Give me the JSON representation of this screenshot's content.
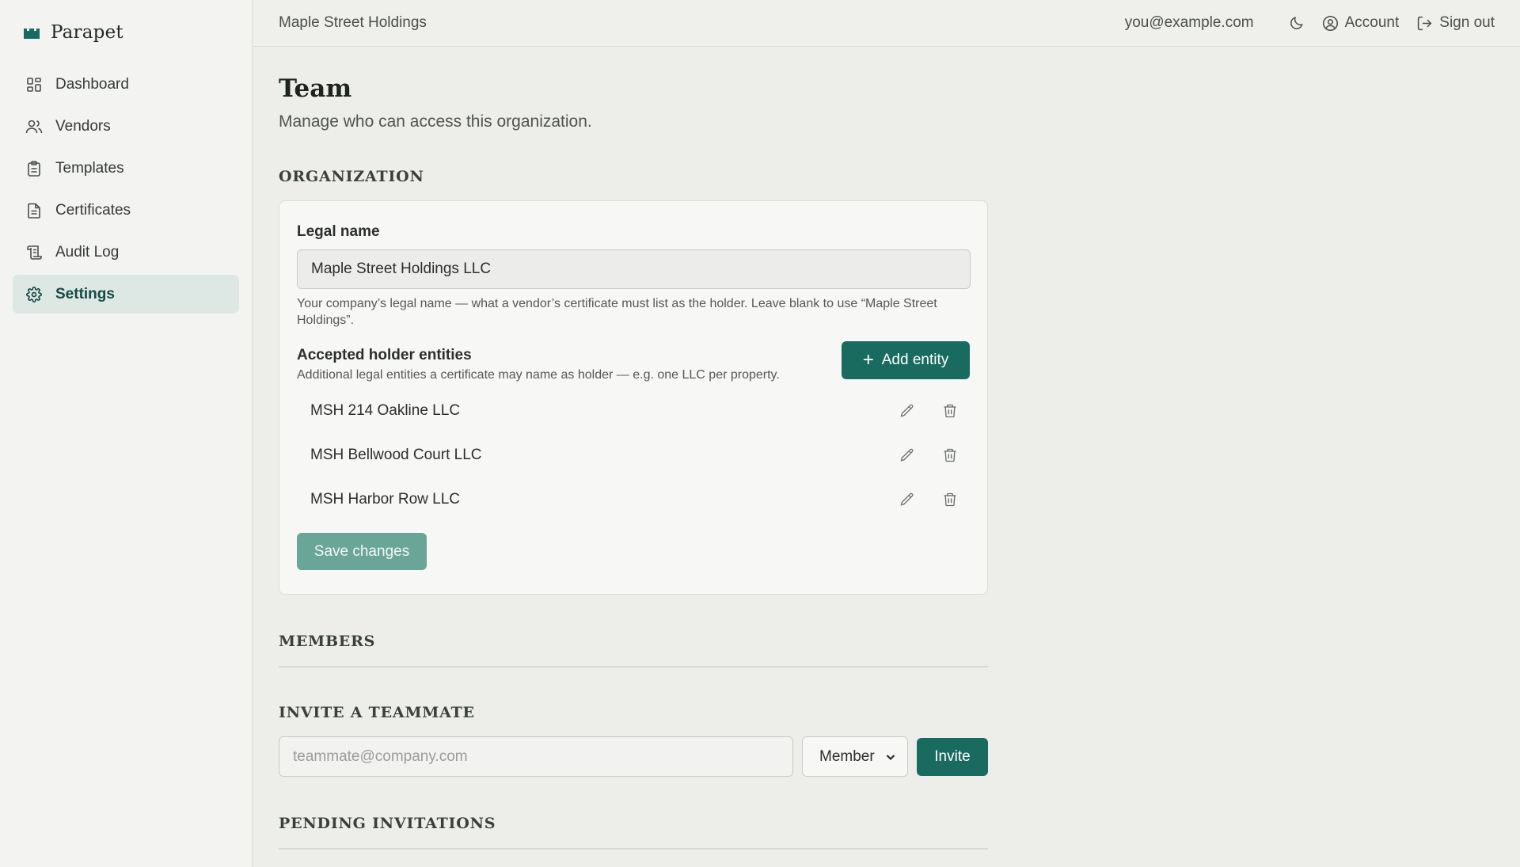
{
  "brand": {
    "name": "Parapet",
    "accent": "#1a6b5f"
  },
  "sidebar": {
    "items": [
      {
        "label": "Dashboard",
        "icon": "dashboard-icon",
        "active": false
      },
      {
        "label": "Vendors",
        "icon": "users-icon",
        "active": false
      },
      {
        "label": "Templates",
        "icon": "clipboard-icon",
        "active": false
      },
      {
        "label": "Certificates",
        "icon": "document-icon",
        "active": false
      },
      {
        "label": "Audit Log",
        "icon": "scroll-icon",
        "active": false
      },
      {
        "label": "Settings",
        "icon": "gear-icon",
        "active": true
      }
    ]
  },
  "topbar": {
    "org": "Maple Street Holdings",
    "email": "you@example.com",
    "account_label": "Account",
    "signout_label": "Sign out"
  },
  "page": {
    "title": "Team",
    "subtitle": "Manage who can access this organization."
  },
  "organization": {
    "heading": "Organization",
    "legal_name_label": "Legal name",
    "legal_name_value": "Maple Street Holdings LLC",
    "legal_name_help": "Your company’s legal name — what a vendor’s certificate must list as the holder. Leave blank to use “Maple Street Holdings”.",
    "entities_title": "Accepted holder entities",
    "entities_desc": "Additional legal entities a certificate may name as holder — e.g. one LLC per property.",
    "add_entity_label": "Add entity",
    "entities": [
      "MSH 214 Oakline LLC",
      "MSH Bellwood Court LLC",
      "MSH Harbor Row LLC"
    ],
    "save_label": "Save changes"
  },
  "members": {
    "heading": "Members"
  },
  "invite": {
    "heading": "Invite a teammate",
    "placeholder": "teammate@company.com",
    "role_value": "Member",
    "invite_label": "Invite"
  },
  "pending": {
    "heading": "Pending invitations"
  }
}
